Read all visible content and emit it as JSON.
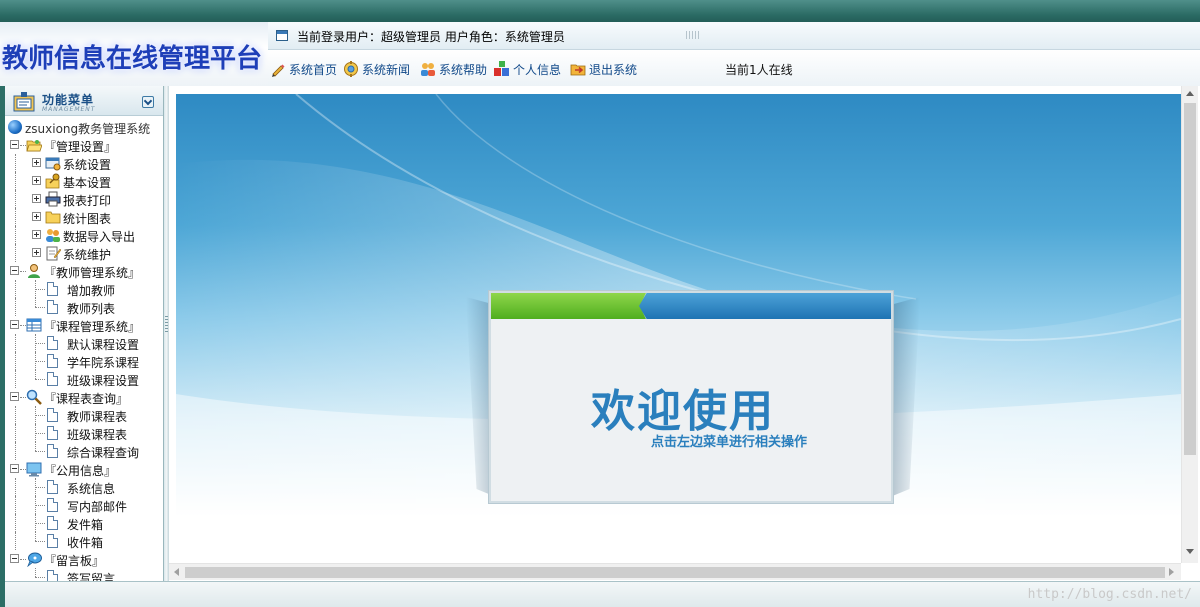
{
  "header": {
    "app_title": "教师信息在线管理平台",
    "user_info": "当前登录用户：超级管理员  用户角色：系统管理员",
    "online_count": "当前1人在线"
  },
  "nav": [
    {
      "label": "系统首页",
      "icon": "pencil-icon"
    },
    {
      "label": "系统新闻",
      "icon": "news-icon"
    },
    {
      "label": "系统帮助",
      "icon": "help-icon"
    },
    {
      "label": "个人信息",
      "icon": "user-blocks-icon"
    },
    {
      "label": "退出系统",
      "icon": "exit-folder-icon"
    }
  ],
  "sidebar": {
    "title": "功能菜单",
    "subtitle": "MANAGEMENT",
    "root": "zsuxiong教务管理系统",
    "groups": [
      {
        "label": "『管理设置』",
        "icon": "folder-open-icon",
        "items": [
          {
            "label": "系统设置",
            "icon": "window-settings-icon",
            "collapsed": true
          },
          {
            "label": "基本设置",
            "icon": "key-folder-icon",
            "collapsed": true
          },
          {
            "label": "报表打印",
            "icon": "printer-icon",
            "collapsed": true
          },
          {
            "label": "统计图表",
            "icon": "folder-icon",
            "collapsed": true
          },
          {
            "label": "数据导入导出",
            "icon": "users-icon",
            "collapsed": true
          },
          {
            "label": "系统维护",
            "icon": "edit-doc-icon",
            "collapsed": true
          }
        ]
      },
      {
        "label": "『教师管理系统』",
        "icon": "person-icon",
        "items": [
          {
            "label": "增加教师"
          },
          {
            "label": "教师列表"
          }
        ]
      },
      {
        "label": "『课程管理系统』",
        "icon": "table-icon",
        "items": [
          {
            "label": "默认课程设置"
          },
          {
            "label": "学年院系课程"
          },
          {
            "label": "班级课程设置"
          }
        ]
      },
      {
        "label": "『课程表查询』",
        "icon": "magnifier-icon",
        "items": [
          {
            "label": "教师课程表"
          },
          {
            "label": "班级课程表"
          },
          {
            "label": "综合课程查询"
          }
        ]
      },
      {
        "label": "『公用信息』",
        "icon": "monitor-icon",
        "items": [
          {
            "label": "系统信息"
          },
          {
            "label": "写内部邮件"
          },
          {
            "label": "发件箱"
          },
          {
            "label": "收件箱"
          }
        ]
      },
      {
        "label": "『留言板』",
        "icon": "chat-bubble-icon",
        "items": [
          {
            "label": "签写留言"
          }
        ]
      }
    ]
  },
  "main": {
    "welcome_title": "欢迎使用",
    "welcome_subtitle": "点击左边菜单进行相关操作"
  },
  "footer": {
    "watermark": "http://blog.csdn.net/"
  },
  "colors": {
    "frame": "#2c6e66",
    "link": "#124a8a",
    "accent_blue": "#2a7fbd",
    "accent_green": "#5cb82a"
  }
}
